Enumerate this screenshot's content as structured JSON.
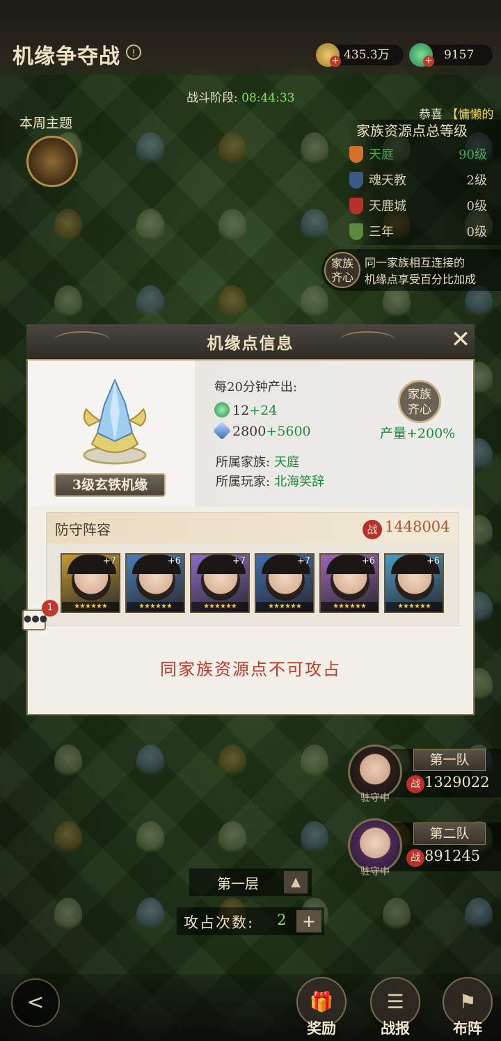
{
  "header": {
    "title": "机缘争夺战",
    "currency": {
      "coins": "435.3万",
      "jade": "9157"
    }
  },
  "battle_phase": {
    "label": "战斗阶段:",
    "time": "08:44:33"
  },
  "weekly_theme_label": "本周主题",
  "marquee": {
    "prefix": "恭喜",
    "highlight": "【慵懒的"
  },
  "family_ranking": {
    "title": "家族资源点总等级",
    "rows": [
      {
        "name": "天庭",
        "level": "90级",
        "color": "#d4702a",
        "highlight": true
      },
      {
        "name": "魂天教",
        "level": "2级",
        "color": "#3c5a86",
        "highlight": false
      },
      {
        "name": "天鹿城",
        "level": "0级",
        "color": "#b8302a",
        "highlight": false
      },
      {
        "name": "三年",
        "level": "0级",
        "color": "#5c8a3a",
        "highlight": false
      }
    ]
  },
  "family_unity": {
    "badge": [
      "家族",
      "齐心"
    ],
    "desc_lines": [
      "同一家族相互连接的",
      "机缘点享受百分比加成"
    ]
  },
  "dialog": {
    "title": "机缘点信息",
    "node_name": "3级玄铁机缘",
    "per_interval": "每20分钟产出:",
    "outputs": [
      {
        "icon": "jade-icon",
        "base": "12",
        "bonus": "+24"
      },
      {
        "icon": "crystal-icon",
        "base": "2800",
        "bonus": "+5600"
      }
    ],
    "family": {
      "label": "所属家族:",
      "value": "天庭"
    },
    "player": {
      "label": "所属玩家:",
      "value": "北海笑辞"
    },
    "unity_badge": [
      "家族",
      "齐心"
    ],
    "yield_label": "产量+200%",
    "defense": {
      "title": "防守阵容",
      "power_icon": "战",
      "power": "1448004",
      "heroes": [
        {
          "plus": "+7",
          "stars": "★★★★★★",
          "frame": "#c59a2d"
        },
        {
          "plus": "+6",
          "stars": "★★★★★★",
          "frame": "#4a7fb8"
        },
        {
          "plus": "+7",
          "stars": "★★★★★★",
          "frame": "#8a6cc8"
        },
        {
          "plus": "+7",
          "stars": "★★★★★★",
          "frame": "#3d6eb0"
        },
        {
          "plus": "+6",
          "stars": "★★★★★★",
          "frame": "#9b66b8"
        },
        {
          "plus": "+6",
          "stars": "★★★★★★",
          "frame": "#4a9bc8"
        }
      ]
    },
    "warning": "同家族资源点不可攻占"
  },
  "chat": {
    "bubble": "●●●",
    "badge": "1"
  },
  "teams": [
    {
      "name": "第一队",
      "status": "驻守中",
      "power_icon": "战",
      "power": "1329022"
    },
    {
      "name": "第二队",
      "status": "驻守中",
      "power_icon": "战",
      "power": "891245"
    }
  ],
  "floor": {
    "label": "第一层",
    "arrow": "▲"
  },
  "attacks": {
    "label": "攻占次数:",
    "value": "2",
    "add": "+"
  },
  "bottom_nav": [
    {
      "label": "奖励",
      "icon": "gift-icon",
      "glyph": "🎁"
    },
    {
      "label": "战报",
      "icon": "scroll-icon",
      "glyph": "☰"
    },
    {
      "label": "布阵",
      "icon": "flag-icon",
      "glyph": "⚑"
    }
  ]
}
